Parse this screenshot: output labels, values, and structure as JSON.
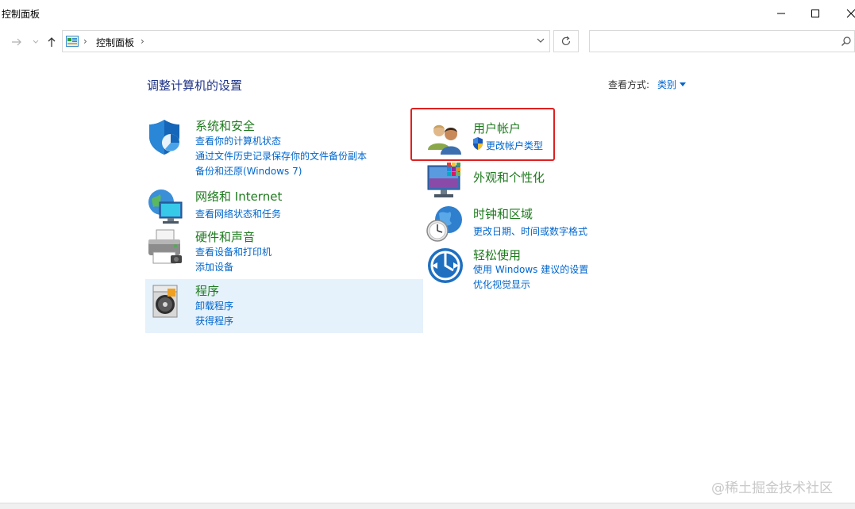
{
  "window": {
    "title": "控制面板"
  },
  "address_bar": {
    "crumb": "控制面板",
    "separator": "›"
  },
  "search": {
    "placeholder": ""
  },
  "main": {
    "heading": "调整计算机的设置",
    "view_by_label": "查看方式:",
    "view_by_value": "类别"
  },
  "categories": {
    "system_security": {
      "title": "系统和安全",
      "links": [
        "查看你的计算机状态",
        "通过文件历史记录保存你的文件备份副本",
        "备份和还原(Windows 7)"
      ]
    },
    "network": {
      "title": "网络和 Internet",
      "links": [
        "查看网络状态和任务"
      ]
    },
    "hardware": {
      "title": "硬件和声音",
      "links": [
        "查看设备和打印机",
        "添加设备"
      ]
    },
    "programs": {
      "title": "程序",
      "links": [
        "卸载程序",
        "获得程序"
      ]
    },
    "user_accounts": {
      "title": "用户帐户",
      "links": [
        "更改帐户类型"
      ]
    },
    "appearance": {
      "title": "外观和个性化",
      "links": []
    },
    "clock_region": {
      "title": "时钟和区域",
      "links": [
        "更改日期、时间或数字格式"
      ]
    },
    "ease_of_access": {
      "title": "轻松使用",
      "links": [
        "使用 Windows 建议的设置",
        "优化视觉显示"
      ]
    }
  },
  "watermark": "@稀土掘金技术社区",
  "colors": {
    "category_title": "#1e7a1e",
    "link": "#0066cc",
    "heading": "#1e3287",
    "highlight": "#e02020",
    "hover_bg": "#e5f1fb"
  }
}
